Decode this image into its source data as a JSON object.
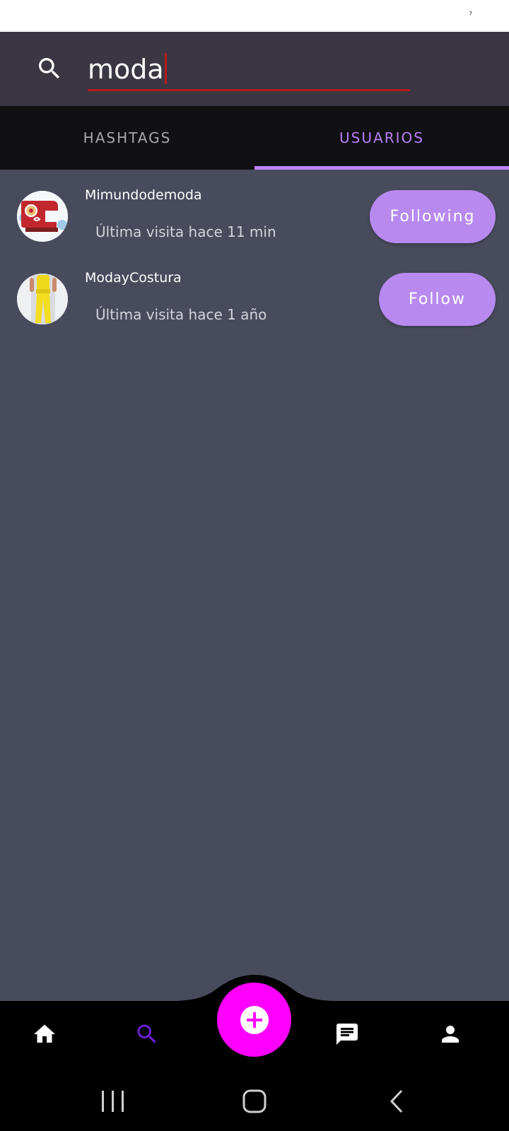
{
  "search": {
    "query": "moda"
  },
  "tabs": [
    {
      "label": "HASHTAGS",
      "active": false
    },
    {
      "label": "USUARIOS",
      "active": true
    }
  ],
  "users": [
    {
      "name": "Mimundodemoda",
      "last_seen": "Última visita hace 11 min",
      "button_label": "Following"
    },
    {
      "name": "ModayCostura",
      "last_seen": "Última visita hace 1 año",
      "button_label": "Follow"
    }
  ],
  "bottom_nav": {
    "items": [
      "home-icon",
      "search-icon",
      "add-icon",
      "chat-icon",
      "profile-icon"
    ],
    "active": "search-icon"
  },
  "colors": {
    "accent": "#bb86fc",
    "fab": "#ff00ff",
    "search_underline": "#b71c1c",
    "active_nav_icon": "#6a1fd6"
  }
}
